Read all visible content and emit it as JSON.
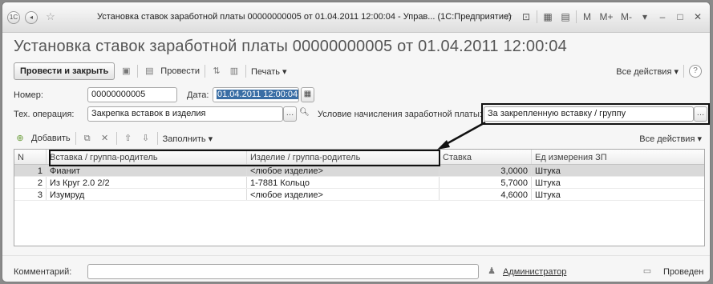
{
  "window": {
    "logo_text": "1С",
    "title": "Установка ставок заработной платы 00000000005 от 01.04.2011 12:00:04 - Управ...  (1С:Предприятие)",
    "title_buttons": [
      "M",
      "M+",
      "M-"
    ]
  },
  "doc_title": "Установка ставок заработной платы 00000000005 от 01.04.2011 12:00:04",
  "toolbar": {
    "post_close_label": "Провести и закрыть",
    "post_label": "Провести",
    "print_label": "Печать ▾",
    "all_actions_label": "Все действия ▾"
  },
  "form": {
    "number_label": "Номер:",
    "number_value": "00000000005",
    "date_label": "Дата:",
    "date_value": "01.04.2011 12:00:04",
    "tech_op_label": "Тех. операция:",
    "tech_op_value": "Закрепка вставок в изделия",
    "condition_label": "Условие начисления заработной платы:",
    "condition_value": "За закрепленную вставку / группу"
  },
  "table_toolbar": {
    "add_label": "Добавить",
    "fill_label": "Заполнить ▾",
    "all_actions_label": "Все действия ▾"
  },
  "table": {
    "columns": [
      "N",
      "Вставка / группа-родитель",
      "Изделие / группа-родитель",
      "Ставка",
      "Ед измерения ЗП"
    ],
    "rows": [
      {
        "n": "1",
        "insert": "Фианит",
        "product": "<любое изделие>",
        "rate": "3,0000",
        "unit": "Штука"
      },
      {
        "n": "2",
        "insert": "Из Круг 2.0 2/2",
        "product": "1-7881 Кольцо",
        "rate": "5,7000",
        "unit": "Штука"
      },
      {
        "n": "3",
        "insert": "Изумруд",
        "product": "<любое изделие>",
        "rate": "4,6000",
        "unit": "Штука"
      }
    ],
    "selected_row": 0
  },
  "footer": {
    "comment_label": "Комментарий:",
    "comment_value": "",
    "author_label": "Администратор",
    "status_label": "Проведен"
  }
}
